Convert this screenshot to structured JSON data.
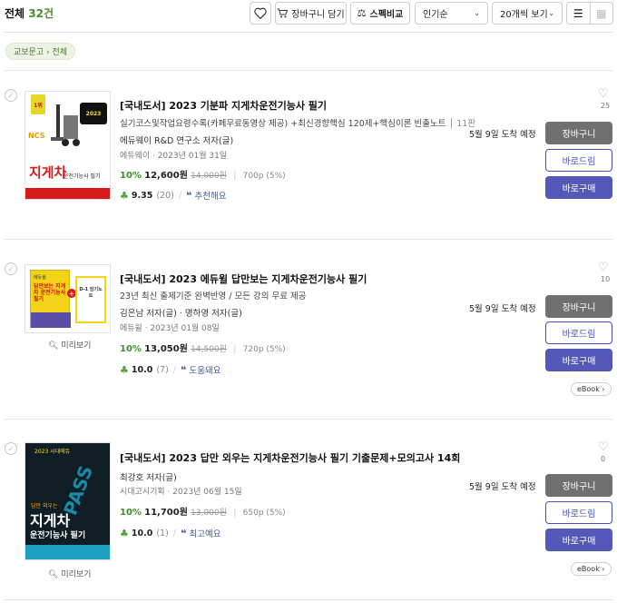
{
  "header": {
    "total_label": "전체",
    "total_count": "32건",
    "cart_label": "장바구니 담기",
    "compare_label": "스펙비교",
    "sort_selected": "인기순",
    "per_page_selected": "20개씩 보기",
    "icons": {
      "wishlist": "heart-icon",
      "cart": "cart-icon",
      "compare": "scale-icon",
      "chevron": "chevron-down-icon",
      "list_view": "list-icon",
      "grid_view": "grid-icon"
    }
  },
  "breadcrumb": "교보문고 › 전체",
  "items": [
    {
      "title": "[국내도서] 2023 기분파 지게차운전기능사 필기",
      "subtitle": "실기코스및작업요령수록(카페무료동영상 제공) +최신경향핵심 120제+핵심이론 빈출노트",
      "pages_tag": "11판",
      "author": "에듀웨이 R&D 연구소 저자(글)",
      "publisher_date": "에듀웨이 · 2023년 01월 31일",
      "discount": "10%",
      "price": "12,600원",
      "original_price": "14,000원",
      "extra": "700p (5%)",
      "rating": "9.35",
      "review_count": "(20)",
      "keyword": "추천해요",
      "delivery": "5월 9일 도착 예정",
      "likes": "25",
      "preview": "",
      "ebook": "",
      "cover": {
        "top_text": "2023",
        "big_text": "지게차",
        "small_text": "운전기능사 필기",
        "badge": "NCS",
        "rank": "1위"
      }
    },
    {
      "title": "[국내도서] 2023 에듀윌 답만보는 지게차운전기능사 필기",
      "subtitle": "23년 최신 출제기준 완벽반영 / 모든 강의 무료 제공",
      "pages_tag": "",
      "author": "김은남 저자(글) · 명하영 저자(글)",
      "publisher_date": "에듀윌 · 2023년 01월 08일",
      "discount": "10%",
      "price": "13,050원",
      "original_price": "14,500원",
      "extra": "720p (5%)",
      "rating": "10.0",
      "review_count": "(7)",
      "keyword": "도움돼요",
      "delivery": "5월 9일 도착 예정",
      "likes": "10",
      "preview": "미리보기",
      "ebook": "eBook",
      "cover": {
        "top_text": "에듀윌",
        "big_text": "답만보는 지게차 운전기능사 필기",
        "small_text": "D-1 암기노트",
        "badge": "",
        "rank": ""
      }
    },
    {
      "title": "[국내도서] 2023 답만 외우는 지게차운전기능사 필기 기출문제+모의고사 14회",
      "subtitle": "",
      "pages_tag": "",
      "author": "최강호 저자(글)",
      "publisher_date": "시대고시기획 · 2023년 06월 15일",
      "discount": "10%",
      "price": "11,700원",
      "original_price": "13,000원",
      "extra": "650p (5%)",
      "rating": "10.0",
      "review_count": "(1)",
      "keyword": "최고예요",
      "delivery": "5월 9일 도착 예정",
      "likes": "0",
      "preview": "미리보기",
      "ebook": "eBook",
      "cover": {
        "top_text": "2023 시대에듀",
        "big_text": "지게차",
        "small_text": "운전기능사 필기",
        "badge": "PASS",
        "rank": "답만 외우는"
      }
    }
  ],
  "buttons": {
    "cart": "장바구니",
    "buy_now": "바로드림",
    "purchase": "바로구매"
  },
  "colors": {
    "accent_green": "#4b8b2f",
    "purchase_blue": "#5458b8",
    "cart_gray": "#707070"
  }
}
